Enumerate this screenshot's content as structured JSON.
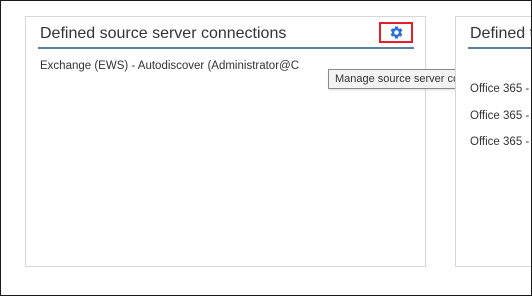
{
  "left_panel": {
    "title": "Defined source server connections",
    "connections": [
      {
        "label": "Exchange (EWS) - Autodiscover (Administrator@C"
      }
    ],
    "manage_button": {
      "icon": "gear-icon",
      "color": "#2f6fd1",
      "highlight_color": "#e0202a"
    },
    "tooltip": "Manage source server connection"
  },
  "right_panel": {
    "title": "Defined t",
    "connections": [
      {
        "label": "Office 365 -"
      },
      {
        "label": "Office 365 -"
      },
      {
        "label": "Office 365 -"
      }
    ]
  }
}
